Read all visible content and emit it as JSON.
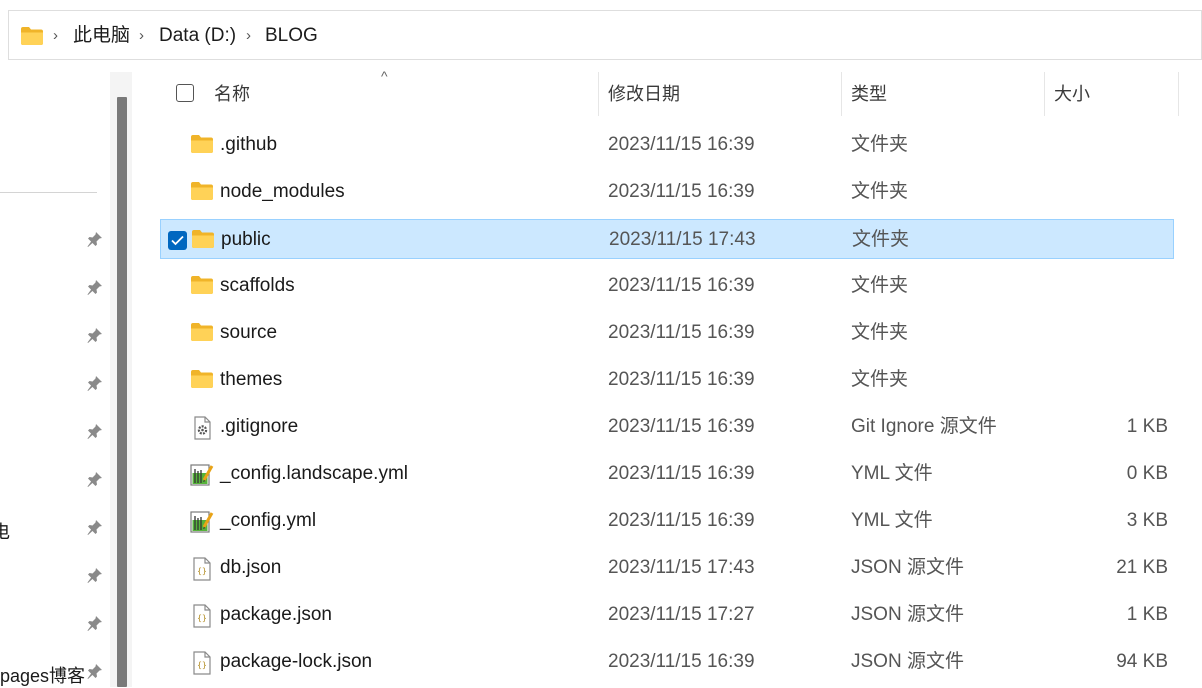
{
  "address": {
    "crumbs": [
      "此电脑",
      "Data (D:)",
      "BLOG"
    ]
  },
  "nav": {
    "cut_text": "电",
    "bottom_label": "pages博客"
  },
  "columns": {
    "name": "名称",
    "date": "修改日期",
    "type": "类型",
    "size": "大小"
  },
  "files": [
    {
      "name": ".github",
      "date": "2023/11/15 16:39",
      "type": "文件夹",
      "size": "",
      "icon": "folder-icon"
    },
    {
      "name": "node_modules",
      "date": "2023/11/15 16:39",
      "type": "文件夹",
      "size": "",
      "icon": "folder-icon"
    },
    {
      "name": "public",
      "date": "2023/11/15 17:43",
      "type": "文件夹",
      "size": "",
      "icon": "folder-icon",
      "selected": true
    },
    {
      "name": "scaffolds",
      "date": "2023/11/15 16:39",
      "type": "文件夹",
      "size": "",
      "icon": "folder-icon"
    },
    {
      "name": "source",
      "date": "2023/11/15 16:39",
      "type": "文件夹",
      "size": "",
      "icon": "folder-icon"
    },
    {
      "name": "themes",
      "date": "2023/11/15 16:39",
      "type": "文件夹",
      "size": "",
      "icon": "folder-icon"
    },
    {
      "name": ".gitignore",
      "date": "2023/11/15 16:39",
      "type": "Git Ignore 源文件",
      "size": "1 KB",
      "icon": "gear-file-icon"
    },
    {
      "name": "_config.landscape.yml",
      "date": "2023/11/15 16:39",
      "type": "YML 文件",
      "size": "0 KB",
      "icon": "yml-file-icon"
    },
    {
      "name": "_config.yml",
      "date": "2023/11/15 16:39",
      "type": "YML 文件",
      "size": "3 KB",
      "icon": "yml-file-icon"
    },
    {
      "name": "db.json",
      "date": "2023/11/15 17:43",
      "type": "JSON 源文件",
      "size": "21 KB",
      "icon": "json-file-icon"
    },
    {
      "name": "package.json",
      "date": "2023/11/15 17:27",
      "type": "JSON 源文件",
      "size": "1 KB",
      "icon": "json-file-icon"
    },
    {
      "name": "package-lock.json",
      "date": "2023/11/15 16:39",
      "type": "JSON 源文件",
      "size": "94 KB",
      "icon": "json-file-icon"
    }
  ],
  "colors": {
    "selection_bg": "#cce8ff",
    "selection_border": "#99d1ff",
    "checkbox_accent": "#0067c0",
    "folder_yellow": "#ffc83d"
  }
}
